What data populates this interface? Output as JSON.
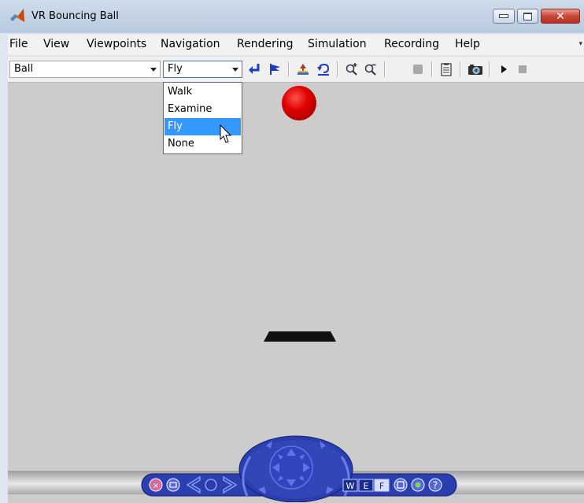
{
  "window": {
    "title": "VR Bouncing Ball",
    "controls": {
      "minimize": "minimize",
      "maximize": "maximize",
      "close": "✕"
    }
  },
  "menubar": {
    "items": [
      "File",
      "View",
      "Viewpoints",
      "Navigation",
      "Rendering",
      "Simulation",
      "Recording",
      "Help"
    ]
  },
  "toolbar": {
    "viewpoint_combo": {
      "value": "Ball"
    },
    "navigation_combo": {
      "value": "Fly",
      "open": true
    },
    "icons": [
      "return-to-viewpoint-icon",
      "flag-icon",
      "straighten-up-icon",
      "undo-move-icon",
      "zoom-in-icon",
      "zoom-out-icon",
      "disabled-icon",
      "clipboard-icon",
      "camera-icon",
      "play-icon",
      "stop-icon"
    ]
  },
  "dropdown": {
    "options": [
      "Walk",
      "Examine",
      "Fly",
      "None"
    ],
    "selected": "Fly"
  },
  "scene": {
    "ball_color": "#e00000",
    "background_color": "#cccccc"
  },
  "navpanel": {
    "labels": {
      "w": "W",
      "e": "E",
      "f": "F",
      "help": "?"
    },
    "color": "#2b3eb0"
  }
}
